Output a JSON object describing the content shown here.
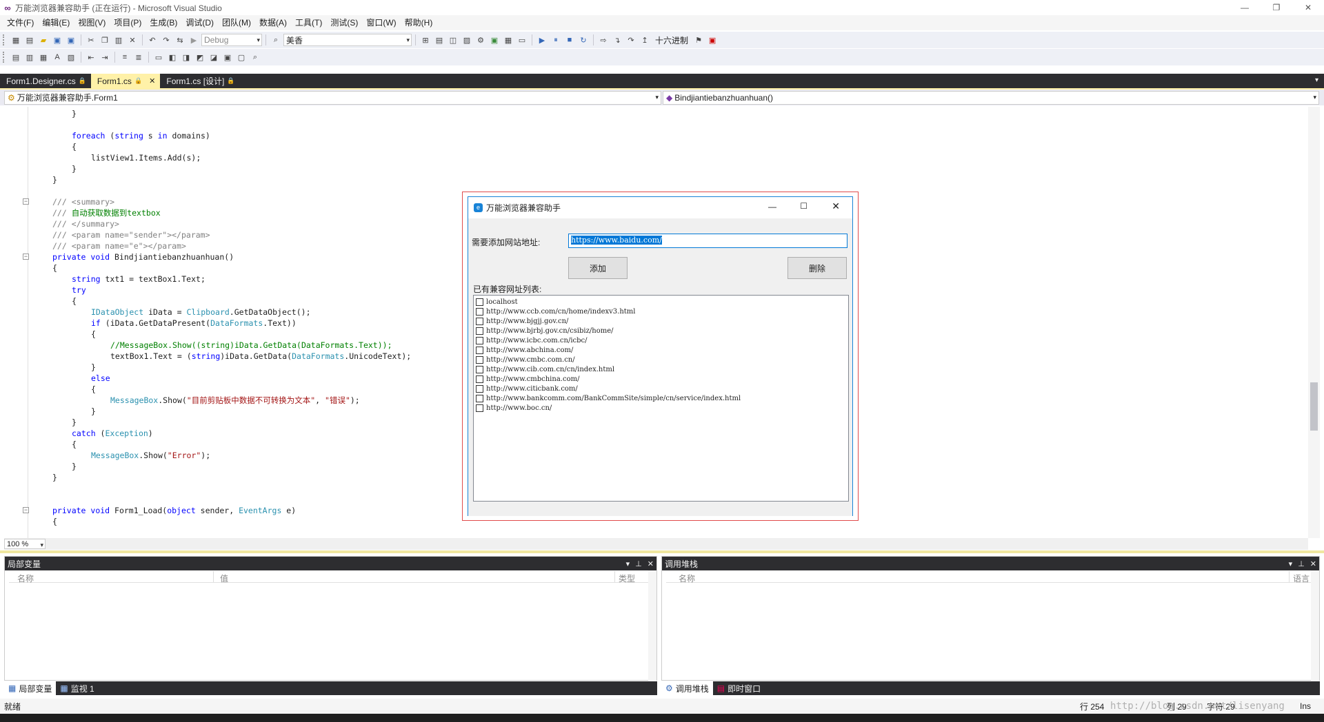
{
  "window": {
    "title": "万能浏览器兼容助手 (正在运行) - Microsoft Visual Studio",
    "controls": [
      "—",
      "❐",
      "✕"
    ]
  },
  "menu": [
    "文件(F)",
    "编辑(E)",
    "视图(V)",
    "项目(P)",
    "生成(B)",
    "调试(D)",
    "团队(M)",
    "数据(A)",
    "工具(T)",
    "测试(S)",
    "窗口(W)",
    "帮助(H)"
  ],
  "toolbar": {
    "config": "Debug",
    "find_value": "美香",
    "hex_label": "十六进制"
  },
  "tabs": [
    {
      "label": "Form1.Designer.cs",
      "locked": "🔒"
    },
    {
      "label": "Form1.cs",
      "locked": "🔒",
      "close": "✕"
    },
    {
      "label": "Form1.cs [设计]",
      "locked": "🔒"
    }
  ],
  "nav": {
    "left": "万能浏览器兼容助手.Form1",
    "right": "Bindjiantiebanzhuanhuan()"
  },
  "code_lines": [
    {
      "i": 2,
      "t": "}"
    },
    {
      "i": 2,
      "t": ""
    },
    {
      "i": 2,
      "t": "foreach (string s in domains)"
    },
    {
      "i": 2,
      "t": "{"
    },
    {
      "i": 3,
      "t": "listView1.Items.Add(s);"
    },
    {
      "i": 2,
      "t": "}"
    },
    {
      "i": 1,
      "t": "}"
    },
    {
      "i": 1,
      "t": ""
    },
    {
      "i": 1,
      "t": "/// <summary>"
    },
    {
      "i": 1,
      "t": "/// 自动获取数据到textbox"
    },
    {
      "i": 1,
      "t": "/// </summary>"
    },
    {
      "i": 1,
      "t": "/// <param name=\"sender\"></param>"
    },
    {
      "i": 1,
      "t": "/// <param name=\"e\"></param>"
    },
    {
      "i": 1,
      "t": "private void Bindjiantiebanzhuanhuan()"
    },
    {
      "i": 1,
      "t": "{"
    },
    {
      "i": 2,
      "t": "string txt1 = textBox1.Text;"
    },
    {
      "i": 2,
      "t": "try"
    },
    {
      "i": 2,
      "t": "{"
    },
    {
      "i": 3,
      "t": "IDataObject iData = Clipboard.GetDataObject();"
    },
    {
      "i": 3,
      "t": "if (iData.GetDataPresent(DataFormats.Text))"
    },
    {
      "i": 3,
      "t": "{"
    },
    {
      "i": 4,
      "t": "//MessageBox.Show((string)iData.GetData(DataFormats.Text));"
    },
    {
      "i": 4,
      "t": "textBox1.Text = (string)iData.GetData(DataFormats.UnicodeText);"
    },
    {
      "i": 3,
      "t": "}"
    },
    {
      "i": 3,
      "t": "else"
    },
    {
      "i": 3,
      "t": "{"
    },
    {
      "i": 4,
      "t": "MessageBox.Show(\"目前剪贴板中数据不可转换为文本\", \"错误\");"
    },
    {
      "i": 3,
      "t": "}"
    },
    {
      "i": 2,
      "t": "}"
    },
    {
      "i": 2,
      "t": "catch (Exception)"
    },
    {
      "i": 2,
      "t": "{"
    },
    {
      "i": 3,
      "t": "MessageBox.Show(\"Error\");"
    },
    {
      "i": 2,
      "t": "}"
    },
    {
      "i": 1,
      "t": "}"
    },
    {
      "i": 1,
      "t": ""
    },
    {
      "i": 1,
      "t": ""
    },
    {
      "i": 1,
      "t": "private void Form1_Load(object sender, EventArgs e)"
    },
    {
      "i": 1,
      "t": "{"
    }
  ],
  "zoom": "100 %",
  "dialog": {
    "title": "万能浏览器兼容助手",
    "url_label": "需要添加网站地址:",
    "url_value": "https://www.baidu.com/",
    "add_button": "添加",
    "delete_button": "删除",
    "list_label": "已有兼容网址列表:",
    "sites": [
      "localhost",
      "http://www.ccb.com/cn/home/indexv3.html",
      "http://www.bjgjj.gov.cn/",
      "http://www.bjrbj.gov.cn/csibiz/home/",
      "http://www.icbc.com.cn/icbc/",
      "http://www.abchina.com/",
      "http://www.cmbc.com.cn/",
      "http://www.cib.com.cn/cn/index.html",
      "http://www.cmbchina.com/",
      "http://www.citicbank.com/",
      "http://www.bankcomm.com/BankCommSite/simple/cn/service/index.html",
      "http://www.boc.cn/"
    ]
  },
  "locals_panel": {
    "title": "局部变量",
    "col_name": "名称",
    "col_value": "值",
    "col_type": "类型",
    "tabs": [
      "局部变量",
      "监视 1"
    ]
  },
  "callstack_panel": {
    "title": "调用堆栈",
    "col_name": "名称",
    "col_lang": "语言",
    "tabs": [
      "调用堆栈",
      "即时窗口"
    ]
  },
  "status": {
    "left": "就绪",
    "line": "行 254",
    "col": "列 29",
    "char": "字符 29",
    "ins": "Ins",
    "watermark": "http://blog.csdn.net/lisenyang"
  }
}
